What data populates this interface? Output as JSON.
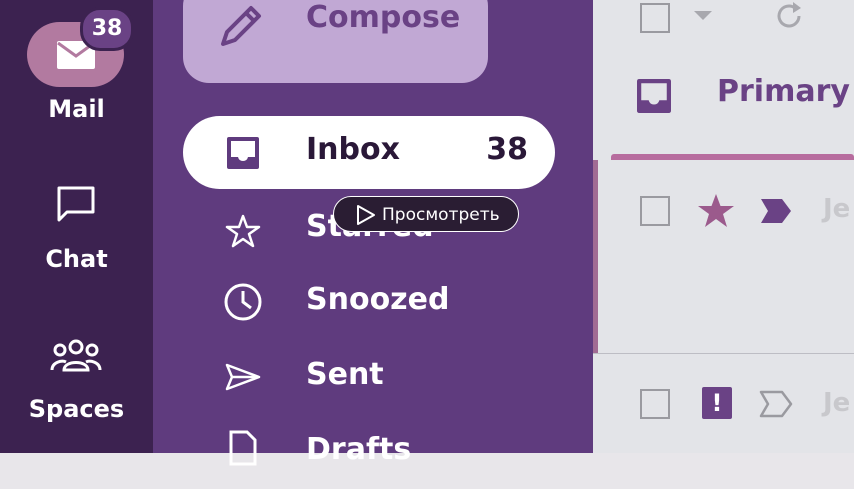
{
  "rail": {
    "items": [
      {
        "label": "Mail",
        "badge": "38",
        "icon": "mail-icon"
      },
      {
        "label": "Chat",
        "icon": "chat-icon"
      },
      {
        "label": "Spaces",
        "icon": "spaces-icon"
      }
    ]
  },
  "nav": {
    "compose_label": "Compose",
    "items": [
      {
        "label": "Inbox",
        "count": "38",
        "icon": "inbox-icon",
        "active": true
      },
      {
        "label": "Starred",
        "icon": "star-icon"
      },
      {
        "label": "Snoozed",
        "icon": "clock-icon"
      },
      {
        "label": "Sent",
        "icon": "send-icon"
      },
      {
        "label": "Drafts",
        "icon": "draft-icon"
      }
    ]
  },
  "tooltip": {
    "label": "Просмотреть",
    "icon": "play-icon"
  },
  "main": {
    "tab_label": "Primary",
    "rows": [
      {
        "sender": "Je",
        "starred": true,
        "important": true
      },
      {
        "sender": "Je",
        "starred": false,
        "important_marker": "!"
      }
    ]
  },
  "colors": {
    "rail_bg": "#3c2250",
    "nav_bg": "#5f3b7e",
    "compose_bg": "#c1a8d4",
    "accent": "#b76c9e",
    "primary_text": "#6a4285"
  }
}
